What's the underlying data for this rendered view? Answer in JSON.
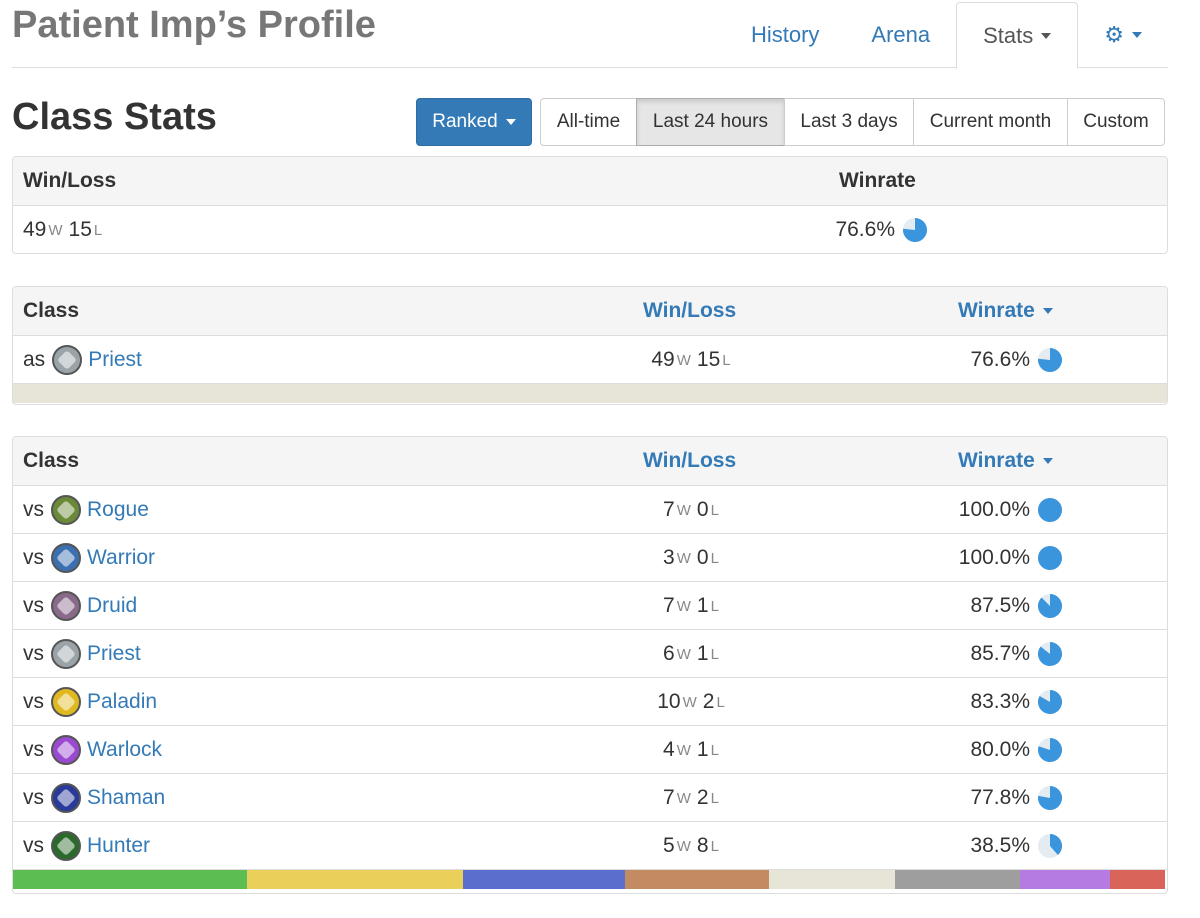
{
  "header": {
    "title": "Patient Imp’s Profile",
    "nav": [
      {
        "label": "History"
      },
      {
        "label": "Arena"
      },
      {
        "label": "Stats"
      }
    ]
  },
  "section": {
    "title": "Class Stats",
    "mode_button": "Ranked",
    "time_filters": [
      "All-time",
      "Last 24 hours",
      "Last 3 days",
      "Current month",
      "Custom"
    ],
    "active_filter": "Last 24 hours"
  },
  "summary": {
    "col_winloss": "Win/Loss",
    "col_winrate": "Winrate",
    "wins": "49",
    "losses": "15",
    "winrate": "76.6%",
    "winrate_value": 0.766
  },
  "as_table": {
    "col_class": "Class",
    "col_winloss": "Win/Loss",
    "col_winrate": "Winrate",
    "rows": [
      {
        "prefix": "as",
        "class": "Priest",
        "wins": "49",
        "losses": "15",
        "winrate": "76.6%",
        "winrate_value": 0.766,
        "icon_color": "#9aa4a8"
      }
    ]
  },
  "vs_table": {
    "col_class": "Class",
    "col_winloss": "Win/Loss",
    "col_winrate": "Winrate",
    "rows": [
      {
        "prefix": "vs",
        "class": "Rogue",
        "wins": "7",
        "losses": "0",
        "winrate": "100.0%",
        "winrate_value": 1.0,
        "icon_color": "#6a8a3a"
      },
      {
        "prefix": "vs",
        "class": "Warrior",
        "wins": "3",
        "losses": "0",
        "winrate": "100.0%",
        "winrate_value": 1.0,
        "icon_color": "#3a6fb0"
      },
      {
        "prefix": "vs",
        "class": "Druid",
        "wins": "7",
        "losses": "1",
        "winrate": "87.5%",
        "winrate_value": 0.875,
        "icon_color": "#8a6a8a"
      },
      {
        "prefix": "vs",
        "class": "Priest",
        "wins": "6",
        "losses": "1",
        "winrate": "85.7%",
        "winrate_value": 0.857,
        "icon_color": "#9aa4a8"
      },
      {
        "prefix": "vs",
        "class": "Paladin",
        "wins": "10",
        "losses": "2",
        "winrate": "83.3%",
        "winrate_value": 0.833,
        "icon_color": "#e0b820"
      },
      {
        "prefix": "vs",
        "class": "Warlock",
        "wins": "4",
        "losses": "1",
        "winrate": "80.0%",
        "winrate_value": 0.8,
        "icon_color": "#9a4ad0"
      },
      {
        "prefix": "vs",
        "class": "Shaman",
        "wins": "7",
        "losses": "2",
        "winrate": "77.8%",
        "winrate_value": 0.778,
        "icon_color": "#2a3a9a"
      },
      {
        "prefix": "vs",
        "class": "Hunter",
        "wins": "5",
        "losses": "8",
        "winrate": "38.5%",
        "winrate_value": 0.385,
        "icon_color": "#2a6a2a"
      }
    ]
  },
  "class_color_bar": [
    {
      "color": "#5cbd53",
      "fraction": 0.203
    },
    {
      "color": "#ead05a",
      "fraction": 0.187
    },
    {
      "color": "#5b6ecd",
      "fraction": 0.14
    },
    {
      "color": "#c28b62",
      "fraction": 0.125
    },
    {
      "color": "#e7e4d8",
      "fraction": 0.109
    },
    {
      "color": "#9e9e9e",
      "fraction": 0.109
    },
    {
      "color": "#b57be3",
      "fraction": 0.078
    },
    {
      "color": "#d9645a",
      "fraction": 0.047
    }
  ],
  "colors": {
    "accent": "#337ab7",
    "pie": "#3a95dc",
    "pie_bg": "#e4ecf2"
  },
  "labels": {
    "wins_suffix": "W",
    "losses_suffix": "L"
  }
}
